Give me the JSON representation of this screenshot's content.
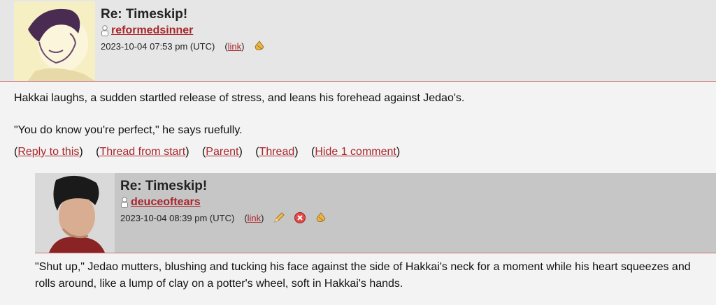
{
  "comments": [
    {
      "title": "Re: Timeskip!",
      "username": "reformedsinner",
      "timestamp": "2023-10-04 07:53 pm (UTC)",
      "link_label": "link",
      "icons": [
        "track-icon"
      ],
      "paragraphs": [
        "Hakkai laughs, a sudden startled release of stress, and leans his forehead against Jedao's.",
        "\"You do know you're perfect,\" he says ruefully."
      ],
      "actions": [
        "Reply to this",
        "Thread from start",
        "Parent",
        "Thread",
        "Hide 1 comment"
      ]
    },
    {
      "title": "Re: Timeskip!",
      "username": "deuceoftears",
      "timestamp": "2023-10-04 08:39 pm (UTC)",
      "link_label": "link",
      "icons": [
        "edit-icon",
        "delete-icon",
        "track-icon"
      ],
      "paragraphs": [
        "\"Shut up,\" Jedao mutters, blushing and tucking his face against the side of Hakkai's neck for a moment while his heart squeezes and rolls around, like a lump of clay on a potter's wheel, soft in Hakkai's hands."
      ]
    }
  ],
  "colors": {
    "accent": "#a8262b",
    "header1_bg": "#e6e6e6",
    "header2_bg": "#c6c6c6",
    "page_bg": "#f3f3f3"
  }
}
